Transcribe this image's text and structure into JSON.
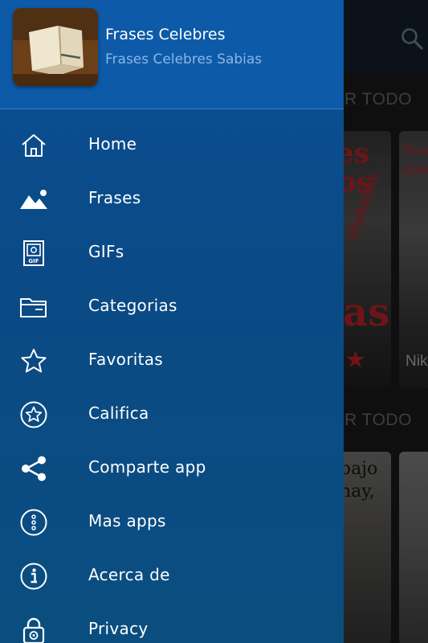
{
  "app": {
    "title": "Frases Celebres",
    "subtitle": "Frases Celebres Sabias"
  },
  "menu": {
    "items": [
      {
        "label": "Home",
        "icon": "home-icon"
      },
      {
        "label": "Frases",
        "icon": "image-icon"
      },
      {
        "label": "GIFs",
        "icon": "gif-file-icon"
      },
      {
        "label": "Categorias",
        "icon": "folder-icon"
      },
      {
        "label": "Favoritas",
        "icon": "star-icon"
      },
      {
        "label": "Califica",
        "icon": "star-circle-icon"
      },
      {
        "label": "Comparte app",
        "icon": "share-icon"
      },
      {
        "label": "Mas apps",
        "icon": "more-circle-icon"
      },
      {
        "label": "Acerca de",
        "icon": "info-icon"
      },
      {
        "label": "Privacy",
        "icon": "lock-icon"
      }
    ]
  },
  "background": {
    "section1_label": "VER TODO",
    "section2_label": "VER TODO",
    "card1_text_top": "es",
    "card1_text_mid": "tos",
    "card1_text_diag": "stoteles",
    "card1_text_big": "as",
    "card2_text": "Nuest\ninsepa",
    "card2_caption": "Nik",
    "card3_text": "bajo\nnay,"
  },
  "colors": {
    "drawer_top": "#0b4f95",
    "drawer_header": "#0d5aa8",
    "subtitle": "#8ab6e6",
    "background_topbar": "#152130"
  }
}
